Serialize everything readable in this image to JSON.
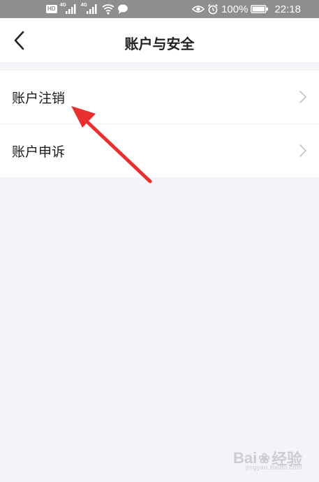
{
  "status_bar": {
    "hd_badge": "HD",
    "net_label_1": "4G",
    "net_label_2": "4G",
    "battery_percent": "100%",
    "time": "22:18",
    "icons": [
      "hd-icon",
      "signal-4g-icon",
      "signal-4g-icon",
      "wifi-icon",
      "message-icon",
      "eye-icon",
      "alarm-icon",
      "battery-icon"
    ]
  },
  "header": {
    "title": "账户与安全",
    "back_icon": "chevron-left-icon"
  },
  "menu": {
    "items": [
      {
        "label": "账户注销",
        "icon": "chevron-right-icon"
      },
      {
        "label": "账户申诉",
        "icon": "chevron-right-icon"
      }
    ]
  },
  "annotation": {
    "arrow_color": "#e8302f"
  },
  "watermark": {
    "brand": "Bai",
    "brand_tail": "经验",
    "sub": "jingyan.baidu.com"
  }
}
